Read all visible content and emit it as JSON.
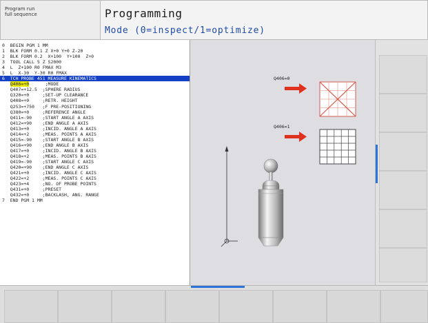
{
  "mode_box": {
    "line1": "Program run",
    "line2": "full sequence"
  },
  "header": {
    "title": "Programming",
    "subtitle": "Mode (0=inspect/1=optimize)"
  },
  "program_lines": [
    "0  BEGIN PGM 1 MM",
    "1  BLK FORM 0.1 Z X+0 Y+0 Z-20",
    "2  BLK FORM 0.2  X+100  Y+100  Z+0",
    "3  TOOL CALL 5 Z S2000",
    "4  L  Z+100 R0 FMAX M3",
    "5  L  X-30  Y-30 R0 FMAX",
    "6  TCH PROBE 451 MEASURE KINEMATICS",
    "   Q406=+0      ;MODE",
    "   Q407=+12.5  ;SPHERE RADIUS",
    "   Q320=+0     ;SET-UP CLEARANCE",
    "   Q408=+0     ;RETR. HEIGHT",
    "   Q253=+750   ;F PRE-POSITIONING",
    "   Q380=+0     ;REFERENCE ANGLE",
    "   Q411=-90    ;START ANGLE A AXIS",
    "   Q412=+90    ;END ANGLE A AXIS",
    "   Q413=+0     ;INCID. ANGLE A AXIS",
    "   Q414=+2     ;MEAS. POINTS A AXIS",
    "   Q415=-90    ;START ANGLE B AXIS",
    "   Q416=+90    ;END ANGLE B AXIS",
    "   Q417=+0     ;INCID. ANGLE B AXIS",
    "   Q418=+2     ;MEAS. POINTS B AXIS",
    "   Q419=-90    ;START ANGLE C AXIS",
    "   Q420=+90    ;END ANGLE C AXIS",
    "   Q421=+0     ;INCID. ANGLE C AXIS",
    "   Q422=+2     ;MEAS. POINTS C AXIS",
    "   Q423=+4     ;NO. OF PROBE POINTS",
    "   Q431=+0     ;PRESET",
    "   Q432=+0     ;BACKLASH, ANG. RANGE",
    "7  END PGM 1 MM"
  ],
  "highlight": {
    "value": "Q406=+0"
  },
  "graphic": {
    "label_inspect": "Q406=0",
    "label_optimize": "Q406=1",
    "arrow_color": "#e0301e",
    "cross_color": "#d45a4a"
  },
  "accent_color": "#2e74d8",
  "selection_color": "#1440c8"
}
